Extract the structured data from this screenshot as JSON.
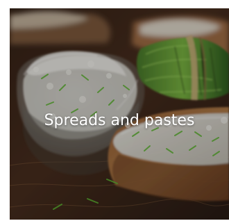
{
  "category_tile": {
    "title": "Spreads and pastes",
    "image_description": "",
    "overlay_color": "#000000"
  }
}
